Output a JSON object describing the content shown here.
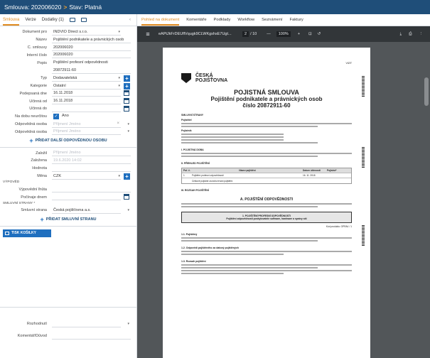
{
  "window": {
    "title": "Smlouva: 202006020",
    "status": "Stav: Platná",
    "separator": ">"
  },
  "left_tabs": [
    "Smlouva",
    "Verze",
    "Dodatky (1)"
  ],
  "left_tabs_active": "Smlouva",
  "collapse_arrow": "‹",
  "form": {
    "dokument_pro": {
      "label": "Dokument pro",
      "value": "INDVIO Direct s.r.o."
    },
    "nazev": {
      "label": "Název",
      "value": "Pojištění podnikatele a právnických osob"
    },
    "cislo_smlouvy": {
      "label": "Č. smlouvy",
      "value": "202006020"
    },
    "interni_cislo": {
      "label": "Interní číslo",
      "value": "202006020"
    },
    "popis": {
      "label": "Popis",
      "value1": "Pojištění profesní odpovědnosti",
      "value2": "20872911-60"
    },
    "typ": {
      "label": "Typ",
      "value": "Dodavatelská"
    },
    "kategorie": {
      "label": "Kategorie",
      "value": "Ostatní"
    },
    "podepsana_dne": {
      "label": "Podepsaná dne",
      "value": "16.11.2018"
    },
    "ucinna_od": {
      "label": "Účinná od",
      "value": "16.11.2018"
    },
    "ucinna_do": {
      "label": "Účinná do",
      "value": ""
    },
    "na_dobu": {
      "label": "Na dobu neurčitou",
      "value": "Ano"
    },
    "odpovedna1": {
      "label": "Odpovědná osoba",
      "value": "Příjmení Jméno"
    },
    "odpovedna2": {
      "label": "Odpovědná osoba",
      "value": "Příjmení Jméno"
    },
    "add_person": "PŘIDAT DALŠÍ ODPOVĚDNOU OSOBU",
    "zalozil": {
      "label": "Založil",
      "value": "Příjmení Jméno"
    },
    "zalozena": {
      "label": "Založena",
      "value": "19.6.2020 14:02"
    },
    "hodnota": {
      "label": "Hodnota",
      "value": ""
    },
    "mena": {
      "label": "Měna",
      "value": "CZK"
    },
    "vypoved_section": "VÝPOVĚD",
    "vypovedni_lhuta": {
      "label": "Výpovědní lhůta",
      "value": ""
    },
    "pocinaje_dnem": {
      "label": "Počínaje dnem",
      "value": ""
    },
    "strany_section": "SMLUVNÍ STRANY *",
    "smluvni_strana": {
      "label": "Smluvní strana",
      "value": "Česká pojišťovna a.s."
    },
    "add_party": "PŘIDAT SMLUVNÍ STRANU",
    "print_button": "TISK KOŠILKY",
    "rozhodnuti": {
      "label": "Rozhodnutí",
      "value": ""
    },
    "komentar": {
      "label": "Komentář/Důvod",
      "value": ""
    }
  },
  "right_tabs": [
    "Pohled na dokument",
    "Komentáře",
    "Podklady",
    "Workflow",
    "Seznámení",
    "Faktury"
  ],
  "right_tabs_active": "Pohled na dokument",
  "pdf": {
    "filename": "eAPtJkFrDEUflVqugk9CLWKgshsE7Ugt...",
    "page_current": "2",
    "page_total": "/ 10",
    "zoom": "100%",
    "minus": "—",
    "plus": "+"
  },
  "doc": {
    "vizit": "VIZIT",
    "logo_line1": "ČESKÁ",
    "logo_line2": "POJIŠŤOVNA",
    "title1": "POJISTNÁ SMLOUVA",
    "title2": "Pojištění podnikatele a právnických osob",
    "title3": "číslo 20872911-60",
    "h_strany": "SMLUVNÍ STRANY",
    "h_pojistitel": "Pojistitel",
    "h_pojistnik": "Pojistník",
    "h_doba": "I. POJISTNÁ DOBA",
    "h_prehled": "II. PŘEHLED POJIŠTĚNÍ",
    "th_poc": "Poř. č.",
    "th_nazev": "Název pojištění",
    "th_ucinnost": "Datum účinnosti",
    "th_pojistne": "Pojistné*",
    "row1_no": "1",
    "row1_name": "Pojištění profesní odpovědnosti",
    "row1_date": "16. 11. 2018",
    "row2_name": "Celkové pojistné za dobu trvání pojištění",
    "h_sazeni": "III. ROZSAH POJIŠTĚNÍ",
    "sub_a": "A. POJIŠTĚNÍ ODPOVĚDNOSTI",
    "box1": "1. POJIŠTĚNÍ PROFESNÍ ODPOVĚDNOSTI",
    "box2": "Pojištění odpovědnosti poskytovatele software, hardware a správy sítí",
    "kod": "Kód produktu: OPRAV / 1",
    "h11": "1.1. Pojištěný",
    "h12": "1.2. Odpovědí pojištěného za datový pojištěných",
    "h13": "1.3. Rozsah pojištění"
  }
}
